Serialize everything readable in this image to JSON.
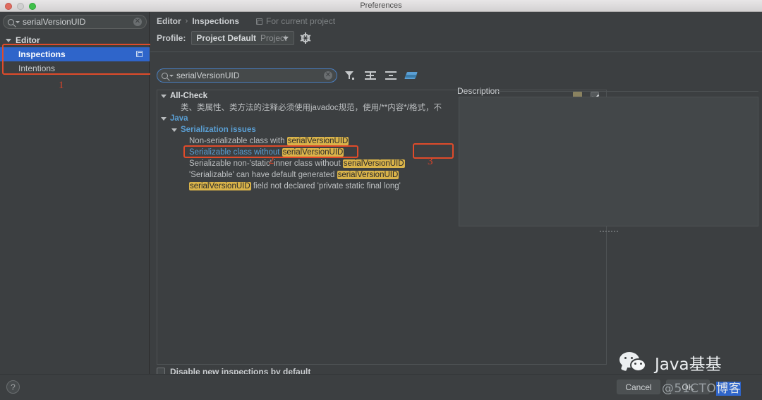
{
  "window": {
    "title": "Preferences",
    "traffic_lights": [
      "close-red",
      "minimize-disabled",
      "zoom-green"
    ]
  },
  "sidebar": {
    "search": {
      "value": "serialVersionUID",
      "icon": "search-icon",
      "clear_icon": "clear-icon"
    },
    "items": [
      {
        "label": "Editor",
        "level": 0,
        "expanded": true,
        "selected": false
      },
      {
        "label": "Inspections",
        "level": 1,
        "expanded": false,
        "selected": true,
        "badge": "copy-icon"
      },
      {
        "label": "Intentions",
        "level": 1,
        "expanded": false,
        "selected": false
      }
    ]
  },
  "header": {
    "breadcrumb": {
      "parent": "Editor",
      "separator": "›",
      "current": "Inspections"
    },
    "scope_note": "For current project",
    "scope_note_icon": "project-scope-icon",
    "profile_label": "Profile:",
    "profile_value": "Project Default",
    "profile_scope": "Project",
    "gear_icon": "gear-icon"
  },
  "toolbar": {
    "search": {
      "value": "serialVersionUID",
      "icon": "search-icon",
      "clear_icon": "clear-icon"
    },
    "buttons": [
      {
        "name": "filter-icon",
        "tooltip": "Filter inspections"
      },
      {
        "name": "expand-all-icon",
        "tooltip": "Expand all"
      },
      {
        "name": "collapse-all-icon",
        "tooltip": "Collapse all"
      },
      {
        "name": "reset-to-defaults-icon",
        "tooltip": "Reset to defaults"
      }
    ]
  },
  "tree": {
    "rows": [
      {
        "indent": 0,
        "type": "group",
        "expanded": true,
        "text": "All-Check",
        "severity": "olive",
        "checkbox": "checked"
      },
      {
        "indent": 2,
        "type": "leaf",
        "text": "类、类属性、类方法的注释必须使用javadoc规范，使用/**内容*/格式，不",
        "severity": "olive",
        "checkbox": "checked"
      },
      {
        "indent": 0,
        "type": "group-blue",
        "expanded": true,
        "text": "Java",
        "severity": "yellow",
        "checkbox": "indeterminate"
      },
      {
        "indent": 1,
        "type": "group-blue",
        "expanded": true,
        "text": "Serialization issues",
        "severity": "yellow",
        "checkbox": "indeterminate"
      },
      {
        "indent": 2,
        "type": "leaf",
        "prefix": "Non-serializable class with ",
        "highlight": "serialVersionUID",
        "suffix": "",
        "severity": "none",
        "checkbox": "unchecked"
      },
      {
        "indent": 2,
        "type": "leaf",
        "selected": true,
        "prefix": "Serializable class without ",
        "highlight": "serialVersionUID",
        "suffix": "",
        "severity": "yellow",
        "checkbox": "checked"
      },
      {
        "indent": 2,
        "type": "leaf",
        "prefix": "Serializable non-'static' inner class without ",
        "highlight": "serialVersionUID",
        "suffix": "",
        "severity": "none",
        "checkbox": "unchecked-dim"
      },
      {
        "indent": 2,
        "type": "leaf",
        "prefix": "'Serializable' can have default generated ",
        "highlight": "serialVersionUID",
        "suffix": "",
        "severity": "none",
        "checkbox": "unchecked-dim"
      },
      {
        "indent": 2,
        "type": "leaf",
        "prefix": "",
        "highlight": "serialVersionUID",
        "suffix": " field not declared 'private static final long'",
        "severity": "none",
        "checkbox": "unchecked"
      }
    ]
  },
  "description": {
    "label": "Description",
    "body": ""
  },
  "footer": {
    "disable_checkbox_label": "Disable new inspections by default",
    "disable_checked": false,
    "help_icon": "?",
    "cancel_label": "Cancel",
    "ok_label": "OK"
  },
  "annotations": [
    {
      "number": "1",
      "target": "sidebar-editor-inspections"
    },
    {
      "number": "2",
      "target": "selected-inspection-row"
    },
    {
      "number": "3",
      "target": "severity-and-enable-checkbox"
    }
  ],
  "watermark": {
    "brand": "Java基基",
    "logo": "wechat-icon",
    "overlay_left": "@51CTO",
    "overlay_right": "博客"
  },
  "colors": {
    "accent_blue": "#2f65ca",
    "link_blue": "#5a9fd4",
    "annotation_red": "#e04b2a",
    "highlight_yellow": "#d9b34a",
    "severity_warning": "#e0a52b",
    "background": "#3c3f41"
  }
}
